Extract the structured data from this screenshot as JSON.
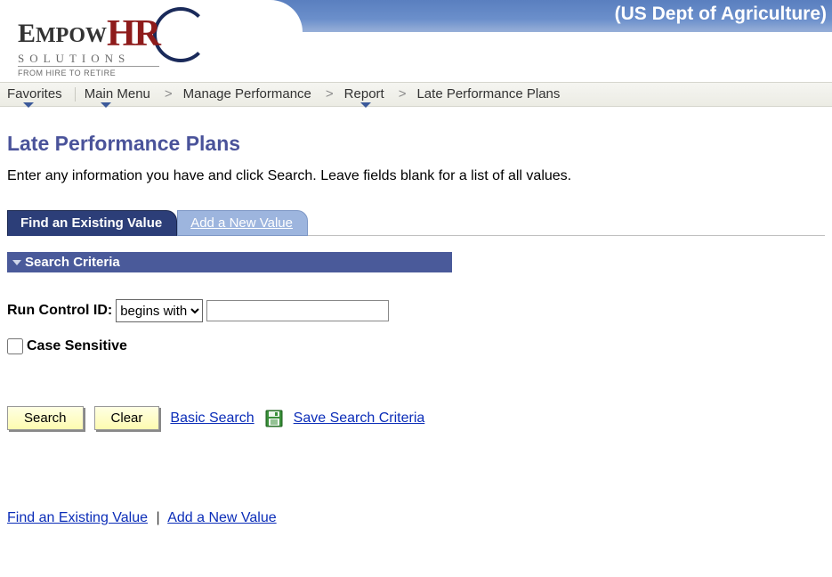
{
  "header": {
    "banner_text": "(US Dept of Agriculture)",
    "logo_main_1": "E",
    "logo_main_2": "MPOW",
    "logo_hr": "HR",
    "logo_sub": "SOLUTIONS",
    "logo_tag": "FROM HIRE TO RETIRE"
  },
  "nav": {
    "favorites": "Favorites",
    "main_menu": "Main Menu",
    "crumb1": "Manage Performance",
    "crumb2": "Report",
    "crumb3": "Late Performance Plans",
    "sep": ">"
  },
  "page": {
    "title": "Late Performance Plans",
    "instructions": "Enter any information you have and click Search. Leave fields blank for a list of all values."
  },
  "tabs": {
    "find": "Find an Existing Value",
    "add": "Add a New Value"
  },
  "section": {
    "search_criteria": "Search Criteria"
  },
  "criteria": {
    "run_control_label": "Run Control ID:",
    "operator_value": "begins with",
    "input_value": "",
    "case_sensitive": "Case Sensitive"
  },
  "buttons": {
    "search": "Search",
    "clear": "Clear",
    "basic_search": "Basic Search",
    "save_criteria": "Save Search Criteria"
  },
  "footer": {
    "find": "Find an Existing Value",
    "add": "Add a New Value",
    "sep": "|"
  }
}
